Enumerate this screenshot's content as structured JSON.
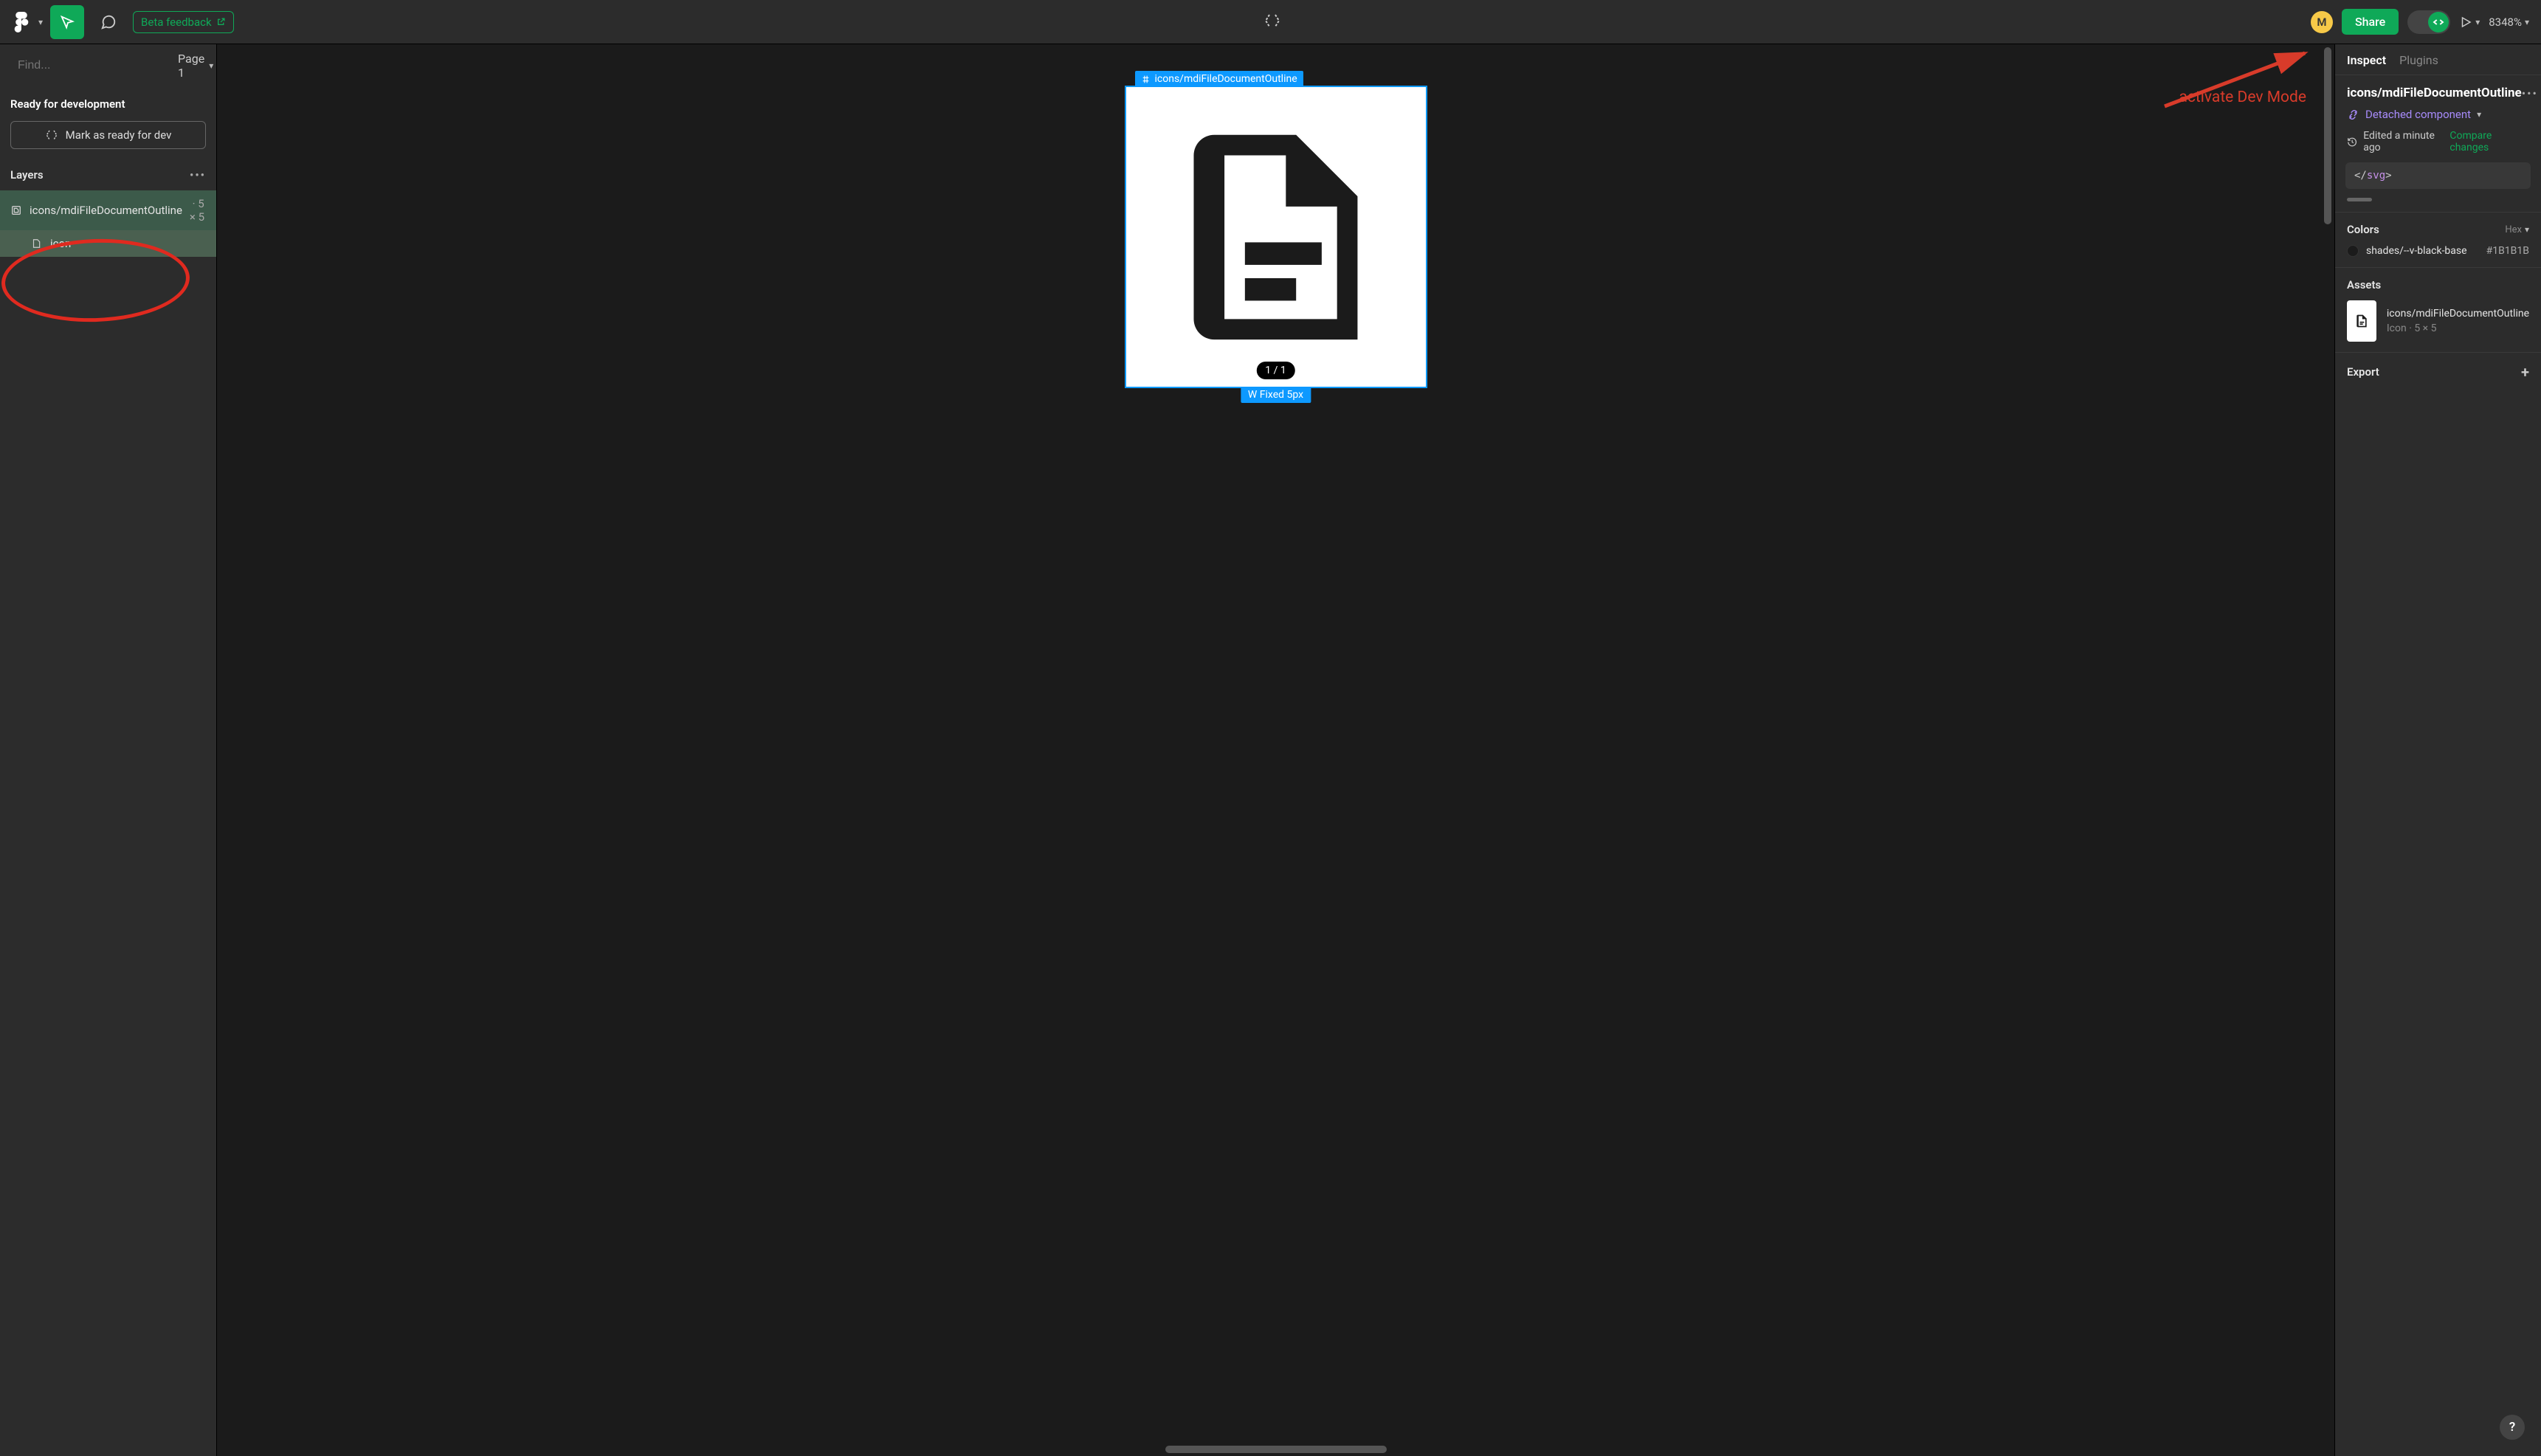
{
  "toolbar": {
    "beta_label": "Beta feedback",
    "avatar_initial": "M",
    "share_label": "Share",
    "zoom": "8348%"
  },
  "left": {
    "search_placeholder": "Find...",
    "page_label": "Page 1",
    "ready_heading": "Ready for development",
    "mark_ready_label": "Mark as ready for dev",
    "layers_heading": "Layers",
    "layer_items": [
      {
        "label": "icons/mdiFileDocumentOutline",
        "dims": "5 × 5"
      },
      {
        "label": "icon"
      }
    ]
  },
  "canvas": {
    "frame_label": "icons/mdiFileDocumentOutline",
    "pager": "1 / 1",
    "width_label": "W Fixed 5px",
    "annotation": "activate Dev Mode"
  },
  "right": {
    "tabs": {
      "inspect": "Inspect",
      "plugins": "Plugins"
    },
    "layer_name": "icons/mdiFileDocumentOutline",
    "detached_label": "Detached component",
    "edited_label": "Edited a minute ago",
    "compare_label": "Compare changes",
    "code_snippet": "</svg>",
    "colors": {
      "heading": "Colors",
      "unit": "Hex",
      "name": "shades/--v-black-base",
      "value": "#1B1B1B"
    },
    "assets": {
      "heading": "Assets",
      "name": "icons/mdiFileDocumentOutline",
      "sub": "Icon · 5 × 5"
    },
    "export_heading": "Export"
  },
  "help": "?"
}
